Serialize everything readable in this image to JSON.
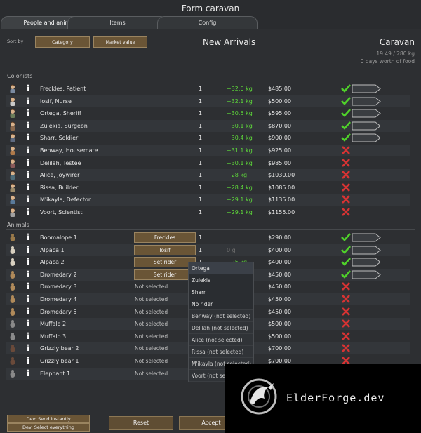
{
  "window": {
    "title": "Form caravan"
  },
  "tabs": [
    {
      "label": "People and animals",
      "active": true
    },
    {
      "label": "Items",
      "active": false
    },
    {
      "label": "Config",
      "active": false
    }
  ],
  "sort": {
    "label": "Sort by",
    "category": "Category",
    "market_value": "Market value"
  },
  "columns": {
    "left_title": "New Arrivals",
    "right_title": "Caravan",
    "mass": "19.49 / 280 kg",
    "food": "0 days worth of food"
  },
  "sections": {
    "colonists": "Colonists",
    "animals": "Animals"
  },
  "colonists": [
    {
      "name": "Freckles, Patient",
      "count": "1",
      "mass": "+32.6 kg",
      "value": "$485.00",
      "status": "check"
    },
    {
      "name": "Iosif, Nurse",
      "count": "1",
      "mass": "+32.1 kg",
      "value": "$500.00",
      "status": "check"
    },
    {
      "name": "Ortega, Sheriff",
      "count": "1",
      "mass": "+30.5 kg",
      "value": "$595.00",
      "status": "check"
    },
    {
      "name": "Zulekia, Surgeon",
      "count": "1",
      "mass": "+30.1 kg",
      "value": "$870.00",
      "status": "check"
    },
    {
      "name": "Sharr, Soldier",
      "count": "1",
      "mass": "+30.4 kg",
      "value": "$900.00",
      "status": "check"
    },
    {
      "name": "Benway, Housemate",
      "count": "1",
      "mass": "+31.1 kg",
      "value": "$925.00",
      "status": "cross"
    },
    {
      "name": "Delilah, Testee",
      "count": "1",
      "mass": "+30.1 kg",
      "value": "$985.00",
      "status": "cross"
    },
    {
      "name": "Alice, Joywirer",
      "count": "1",
      "mass": "+28 kg",
      "value": "$1030.00",
      "status": "cross"
    },
    {
      "name": "Rissa, Builder",
      "count": "1",
      "mass": "+28.4 kg",
      "value": "$1085.00",
      "status": "cross"
    },
    {
      "name": "M'ikayla, Defector",
      "count": "1",
      "mass": "+29.1 kg",
      "value": "$1135.00",
      "status": "cross"
    },
    {
      "name": "Voort, Scientist",
      "count": "1",
      "mass": "+29.1 kg",
      "value": "$1155.00",
      "status": "cross"
    }
  ],
  "animals": [
    {
      "name": "Boomalope 1",
      "rider": "Freckles",
      "rider_button": true,
      "count": "1",
      "mass": "",
      "value": "$290.00",
      "status": "check"
    },
    {
      "name": "Alpaca 1",
      "rider": "Iosif",
      "rider_button": true,
      "count": "1",
      "mass": "0 g",
      "value": "$400.00",
      "status": "check"
    },
    {
      "name": "Alpaca 2",
      "rider": "Set rider",
      "rider_button": true,
      "count": "1",
      "mass": "+25 kg",
      "value": "$400.00",
      "status": "check"
    },
    {
      "name": "Dromedary 2",
      "rider": "Set rider",
      "rider_button": true,
      "count": "1",
      "mass": "",
      "value": "$450.00",
      "status": "check"
    },
    {
      "name": "Dromedary 3",
      "rider": "Not selected",
      "rider_button": false,
      "count": "",
      "mass": "",
      "value": "$450.00",
      "status": "cross"
    },
    {
      "name": "Dromedary 4",
      "rider": "Not selected",
      "rider_button": false,
      "count": "",
      "mass": "",
      "value": "$450.00",
      "status": "cross"
    },
    {
      "name": "Dromedary 5",
      "rider": "Not selected",
      "rider_button": false,
      "count": "",
      "mass": "",
      "value": "$450.00",
      "status": "cross"
    },
    {
      "name": "Muffalo 2",
      "rider": "Not selected",
      "rider_button": false,
      "count": "",
      "mass": "",
      "value": "$500.00",
      "status": "cross"
    },
    {
      "name": "Muffalo 3",
      "rider": "Not selected",
      "rider_button": false,
      "count": "",
      "mass": "",
      "value": "$500.00",
      "status": "cross"
    },
    {
      "name": "Grizzly bear 2",
      "rider": "Not selected",
      "rider_button": false,
      "count": "",
      "mass": "",
      "value": "$700.00",
      "status": "cross"
    },
    {
      "name": "Grizzly bear 1",
      "rider": "Not selected",
      "rider_button": false,
      "count": "",
      "mass": "",
      "value": "$700.00",
      "status": "cross"
    },
    {
      "name": "Elephant 1",
      "rider": "Not selected",
      "rider_button": false,
      "count": "",
      "mass": "",
      "value": "",
      "status": "none"
    }
  ],
  "dropdown": [
    "Ortega",
    "Zulekia",
    "Sharr",
    "No rider",
    "Benway (not selected)",
    "Delilah (not selected)",
    "Alice (not selected)",
    "Rissa (not selected)",
    "M'ikayla (not selected)",
    "Voort (not selected)"
  ],
  "footer": {
    "dev_send": "Dev: Send instantly",
    "dev_select": "Dev: Select everything",
    "reset": "Reset",
    "accept": "Accept"
  },
  "banner": {
    "text": "ElderForge.dev"
  },
  "colors": {
    "check": "#4fd12a",
    "cross": "#d63333",
    "button": "#6a5536",
    "background": "#2d2f32"
  }
}
